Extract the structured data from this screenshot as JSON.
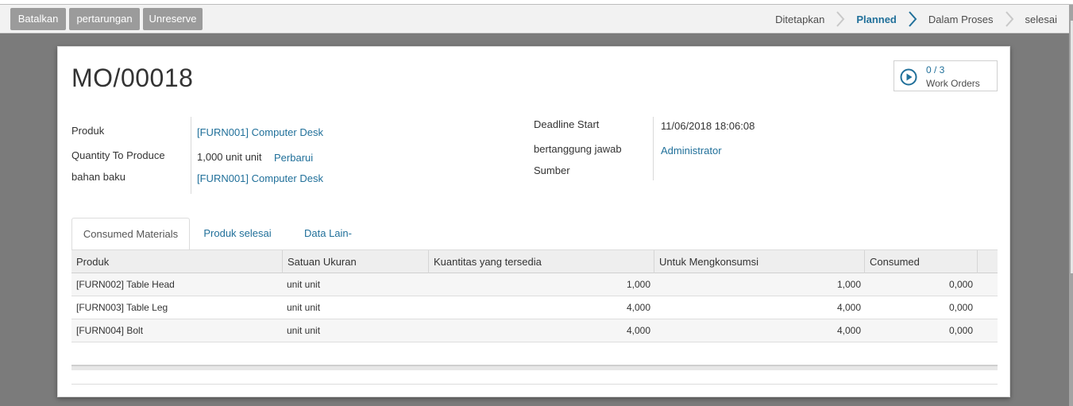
{
  "actions": {
    "cancel": "Batalkan",
    "match": "pertarungan",
    "unreserve": "Unreserve"
  },
  "stages": {
    "s1": "Ditetapkan",
    "s2": "Planned",
    "s3": "Dalam Proses",
    "s4": "selesai"
  },
  "work_orders": {
    "count": "0 / 3",
    "label": "Work Orders"
  },
  "record": {
    "title": "MO/00018",
    "product_label": "Produk",
    "product_value": "[FURN001] Computer Desk",
    "qty_label": "Quantity To Produce",
    "qty_value": "1,000",
    "qty_unit": "unit unit",
    "qty_update": "Perbarui",
    "bom_label": "bahan baku",
    "bom_value": "[FURN001] Computer Desk",
    "deadline_label": "Deadline Start",
    "deadline_value": "11/06/2018 18:06:08",
    "responsible_label": "bertanggung jawab",
    "responsible_value": "Administrator",
    "source_label": "Sumber"
  },
  "tabs": {
    "t1": "Consumed Materials",
    "t2": "Produk selesai",
    "t3": "Data Lain-lain"
  },
  "table": {
    "headers": {
      "product": "Produk",
      "uom": "Satuan Ukuran",
      "available": "Kuantitas yang tersedia",
      "to_consume": "Untuk Mengkonsumsi",
      "consumed": "Consumed"
    },
    "rows": [
      {
        "product": "[FURN002] Table Head",
        "uom": "unit unit",
        "available": "1,000",
        "to_consume": "1,000",
        "consumed": "0,000"
      },
      {
        "product": "[FURN003] Table Leg",
        "uom": "unit unit",
        "available": "4,000",
        "to_consume": "4,000",
        "consumed": "0,000"
      },
      {
        "product": "[FURN004] Bolt",
        "uom": "unit unit",
        "available": "4,000",
        "to_consume": "4,000",
        "consumed": "0,000"
      }
    ]
  },
  "colors": {
    "link": "#21709a",
    "button": "#9b9b9b"
  }
}
